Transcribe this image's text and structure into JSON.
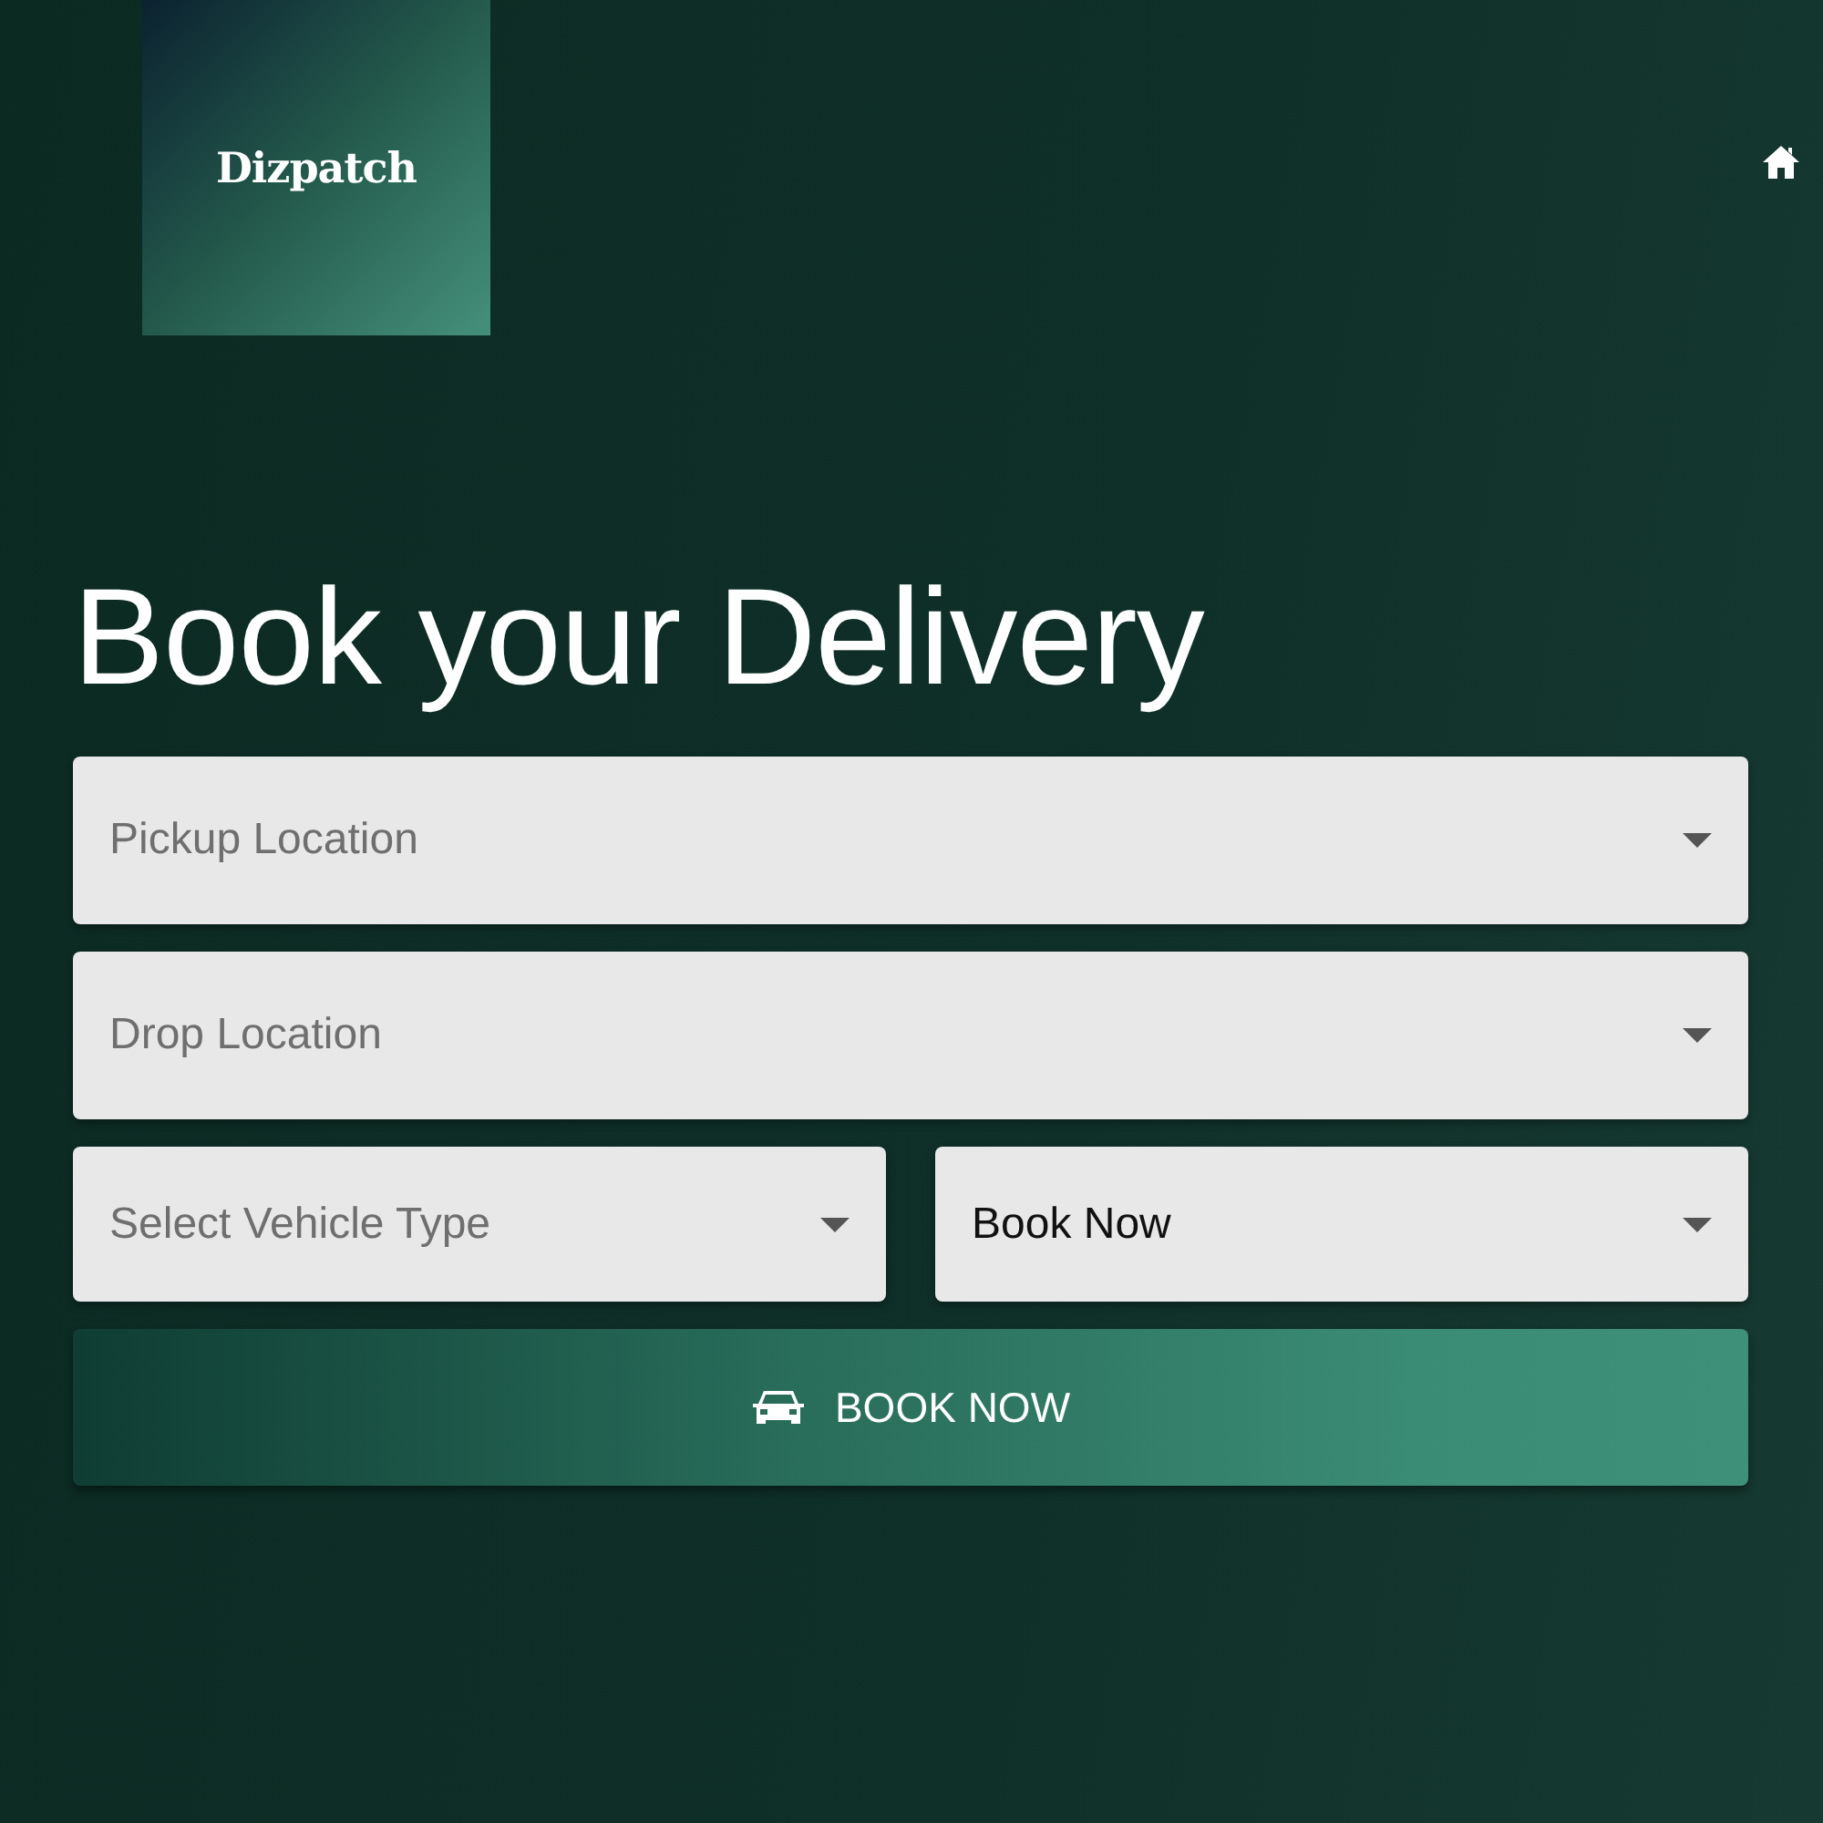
{
  "header": {
    "logo": "Dizpatch"
  },
  "heading": "Book your Delivery",
  "fields": [
    {
      "placeholder": "Pickup Location"
    },
    {
      "placeholder": "Drop Location"
    },
    {
      "placeholder": "Select Vehicle Type"
    },
    {
      "value": "Book Now"
    }
  ],
  "submit_button": {
    "label": "BOOK NOW"
  }
}
